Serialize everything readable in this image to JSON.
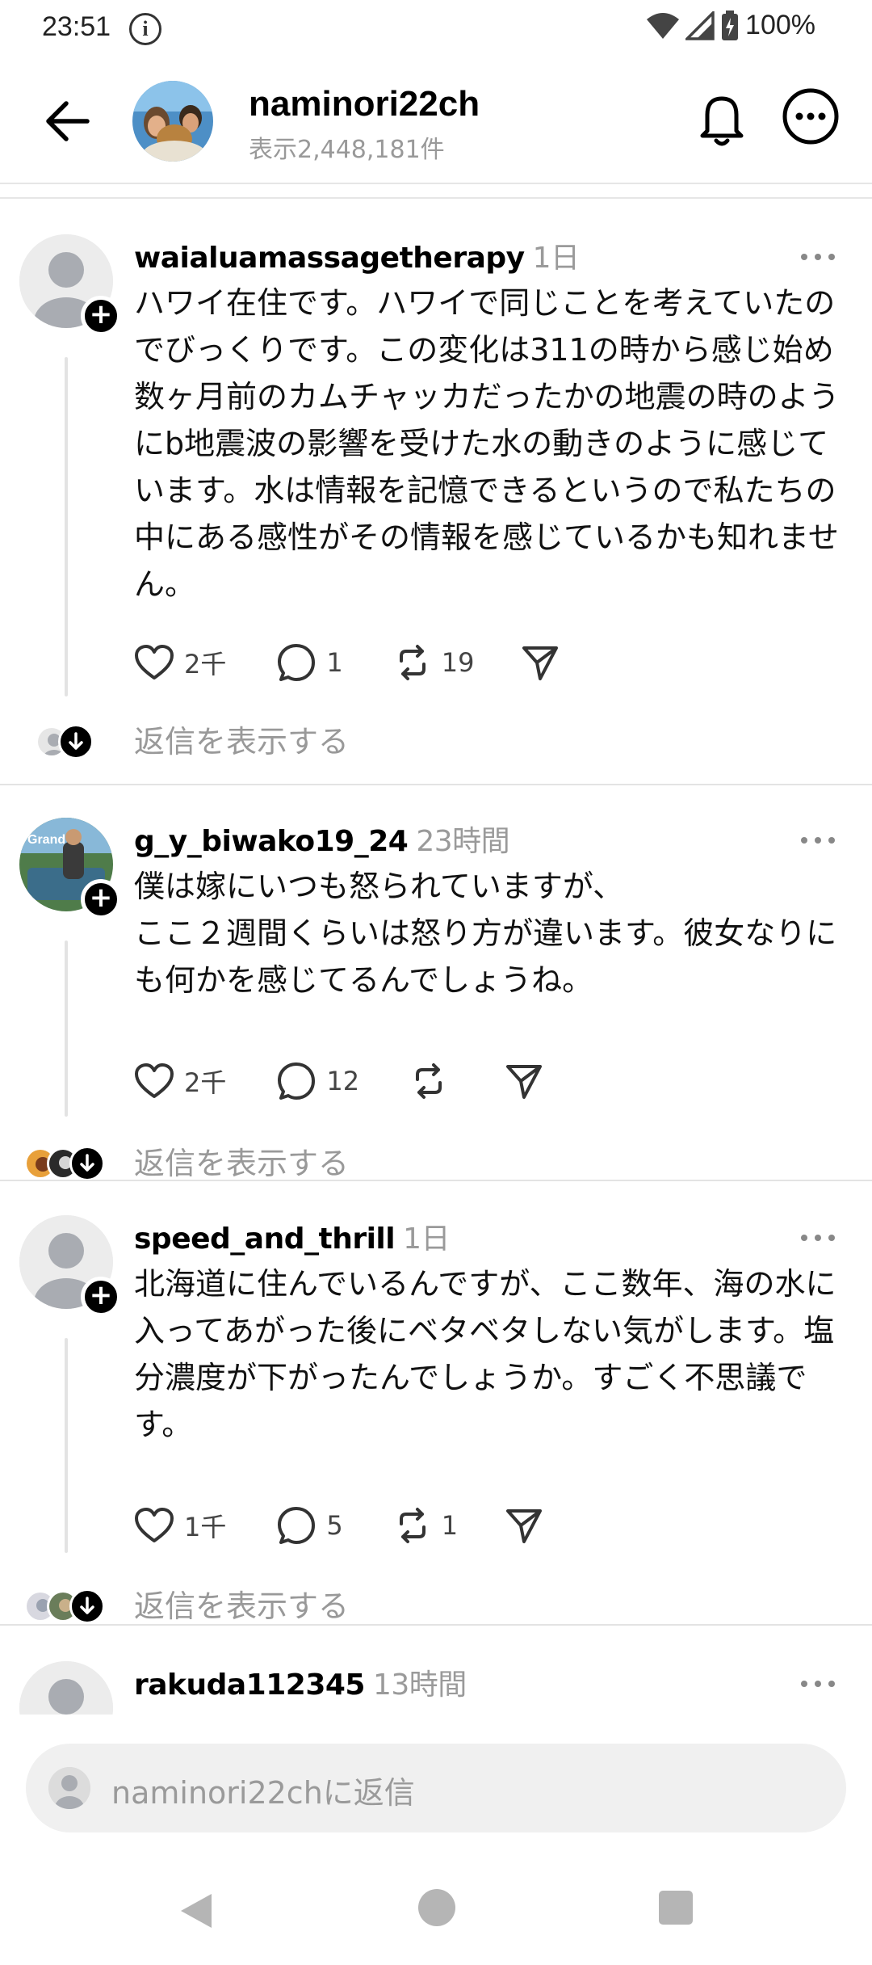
{
  "status_bar": {
    "time": "23:51",
    "battery": "100%"
  },
  "header": {
    "title": "naminori22ch",
    "views": "表示2,448,181件"
  },
  "comments": [
    {
      "username": "waialuamassagetherapy",
      "time": "1日",
      "text": "ハワイ在住です。ハワイで同じことを考えていたのでびっくりです。この変化は311の時から感じ始め　数ヶ月前のカムチャッカだったかの地震の時のようにb地震波の影響を受けた水の動きのように感じています。水は情報を記憶できるというので私たちの中にある感性がその情報を感じているかも知れません。",
      "likes": "2千",
      "replies": "1",
      "reposts": "19",
      "show_replies": "返信を表示する"
    },
    {
      "username": "g_y_biwako19_24",
      "time": "23時間",
      "text": "僕は嫁にいつも怒られていますが、\nここ２週間くらいは怒り方が違います。彼女なりにも何かを感じてるんでしょうね。",
      "likes": "2千",
      "replies": "12",
      "reposts": "",
      "show_replies": "返信を表示する"
    },
    {
      "username": "speed_and_thrill",
      "time": "1日",
      "text": "北海道に住んでいるんですが、ここ数年、海の水に入ってあがった後にベタベタしない気がします。塩分濃度が下がったんでしょうか。すごく不思議です。",
      "likes": "1千",
      "replies": "5",
      "reposts": "1",
      "show_replies": "返信を表示する"
    },
    {
      "username": "rakuda112345",
      "time": "13時間"
    }
  ],
  "reply_bar": {
    "placeholder": "naminori22chに返信"
  },
  "colors": {
    "accent": "#000000",
    "muted": "#9a9a9a",
    "divider": "#e3e3e3"
  },
  "icons": [
    "back-arrow-icon",
    "bell-icon",
    "more-icon",
    "heart-icon",
    "comment-icon",
    "repost-icon",
    "share-icon",
    "plus-icon",
    "chevron-down-icon"
  ]
}
